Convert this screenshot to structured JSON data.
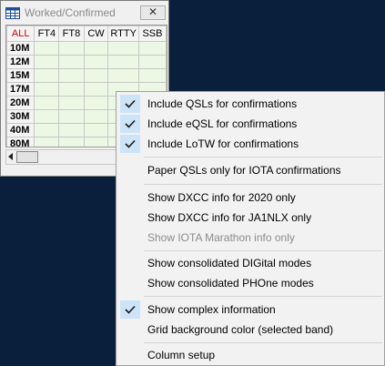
{
  "window": {
    "title": "Worked/Confirmed",
    "close_symbol": "✕",
    "icon": "grid-icon"
  },
  "grid": {
    "columns": [
      "ALL",
      "FT4",
      "FT8",
      "CW",
      "RTTY",
      "SSB"
    ],
    "bands": [
      "10M",
      "12M",
      "15M",
      "17M",
      "20M",
      "30M",
      "40M",
      "80M"
    ]
  },
  "menu": {
    "items": [
      {
        "label": "Include QSLs for confirmations",
        "checked": true,
        "enabled": true
      },
      {
        "label": "Include eQSL for confirmations",
        "checked": true,
        "enabled": true
      },
      {
        "label": "Include LoTW for confirmations",
        "checked": true,
        "enabled": true
      },
      {
        "label": "Paper QSLs only for IOTA confirmations",
        "checked": false,
        "enabled": true
      },
      {
        "label": "Show DXCC info for 2020 only",
        "checked": false,
        "enabled": true
      },
      {
        "label": "Show DXCC info for JA1NLX only",
        "checked": false,
        "enabled": true
      },
      {
        "label": "Show IOTA Marathon info only",
        "checked": false,
        "enabled": false
      },
      {
        "label": "Show consolidated DIGital modes",
        "checked": false,
        "enabled": true
      },
      {
        "label": "Show consolidated PHOne modes",
        "checked": false,
        "enabled": true
      },
      {
        "label": "Show complex information",
        "checked": true,
        "enabled": true
      },
      {
        "label": "Grid background color (selected band)",
        "checked": false,
        "enabled": true
      },
      {
        "label": "Column setup",
        "checked": false,
        "enabled": true
      }
    ]
  }
}
